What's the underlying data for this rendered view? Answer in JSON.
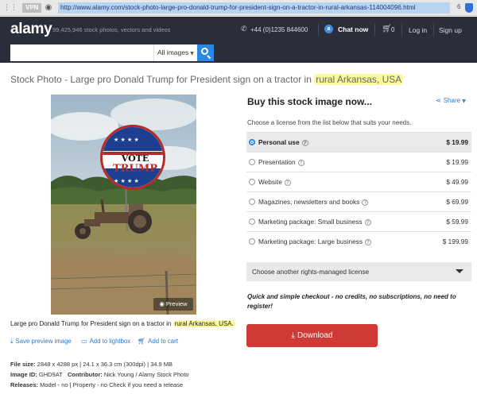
{
  "browser": {
    "vpn_label": "VPN",
    "url": "http://www.alamy.com/stock-photo-large-pro-donald-trump-for-president-sign-on-a-tractor-in-rural-arkansas-114004096.html",
    "badge_count": "6",
    "grip_icon": "grid-icon",
    "world_icon": "globe-icon"
  },
  "header": {
    "logo": "alamy",
    "stock_count": "99,425,946  stock photos, vectors and videos",
    "phone": "+44 (0)1235 844600",
    "chat_badge": "a",
    "chat_label": "Chat now",
    "cart_count": "0",
    "login_label": "Log in",
    "signup_label": "Sign up"
  },
  "search": {
    "placeholder": "",
    "filter_label": "All images"
  },
  "page": {
    "title_before": "Stock Photo - Large pro Donald Trump for President sign on a tractor in ",
    "title_highlight": "rural Arkansas, USA",
    "caption_before": "Large pro Donald Trump for President sign on a tractor in ",
    "caption_highlight": "rural Arkansas, USA.",
    "preview_label": "Preview",
    "sign_top": "VOTE",
    "sign_bottom": "TRUMP"
  },
  "actions": {
    "save_preview": "Save preview image",
    "add_lightbox": "Add to lightbox",
    "add_cart": "Add to cart"
  },
  "meta": {
    "file_size_label": "File size:",
    "file_size_value": "2848 x 4288 px | 24.1 x 36.3 cm (300dpi) | 34.9 MB",
    "image_id_label": "Image ID:",
    "image_id_value": "GHD9AT",
    "contributor_label": "Contributor:",
    "contributor_value": "Nick Young / Alamy Stock Photo",
    "releases_label": "Releases:",
    "releases_value": "Model - no | Property - no   Check if you need a release"
  },
  "purchase": {
    "title": "Buy this stock image now...",
    "share_label": "Share",
    "intro": "Choose a license from the list below that suits your needs.",
    "options": [
      {
        "name": "Personal use",
        "price": "$ 19.99",
        "selected": true
      },
      {
        "name": "Presentation",
        "price": "$ 19.99",
        "selected": false
      },
      {
        "name": "Website",
        "price": "$ 49.99",
        "selected": false
      },
      {
        "name": "Magazines, newsletters and books",
        "price": "$ 69.99",
        "selected": false
      },
      {
        "name": "Marketing package: Small business",
        "price": "$ 59.99",
        "selected": false
      },
      {
        "name": "Marketing package: Large business",
        "price": "$ 199.99",
        "selected": false
      }
    ],
    "rm_label": "Choose another rights-managed license",
    "checkout_note": "Quick and simple checkout - no credits, no subscriptions, no need to register!",
    "download_label": "Download"
  },
  "colors": {
    "header_bg": "#2b2d3a",
    "accent_blue": "#2a88e1",
    "download_red": "#cf3a36",
    "highlight": "#fbfa9a"
  }
}
